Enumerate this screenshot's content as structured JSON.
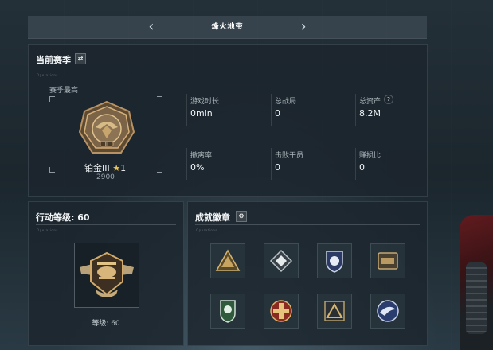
{
  "header": {
    "title": "烽火地带"
  },
  "season": {
    "title": "当前赛季",
    "subtitle_tiny": "Operations",
    "best_label": "赛季最高",
    "rank_name": "铂金III",
    "rank_star_count": "1",
    "rank_score": "2900",
    "stats": [
      {
        "label": "游戏时长",
        "value": "0min"
      },
      {
        "label": "总战局",
        "value": "0"
      },
      {
        "label": "总资产",
        "value": "8.2M"
      },
      {
        "label": "撤离率",
        "value": "0%"
      },
      {
        "label": "击败干员",
        "value": "0"
      },
      {
        "label": "赚损比",
        "value": "0"
      }
    ],
    "help_glyph": "?"
  },
  "level": {
    "title": "行动等级: 60",
    "tiny": "Operations",
    "level_text": "等级: 60"
  },
  "achievements": {
    "title": "成就徽章",
    "tiny": "Operations",
    "badges": [
      "mountain-badge-icon",
      "diamond-badge-icon",
      "eagle-shield-badge-icon",
      "bunker-badge-icon",
      "green-shield-badge-icon",
      "red-cross-badge-icon",
      "triangle-badge-icon",
      "blue-wing-badge-icon"
    ]
  },
  "colors": {
    "accent_gold": "#c9a25a",
    "panel_bg": "#1c262e"
  }
}
